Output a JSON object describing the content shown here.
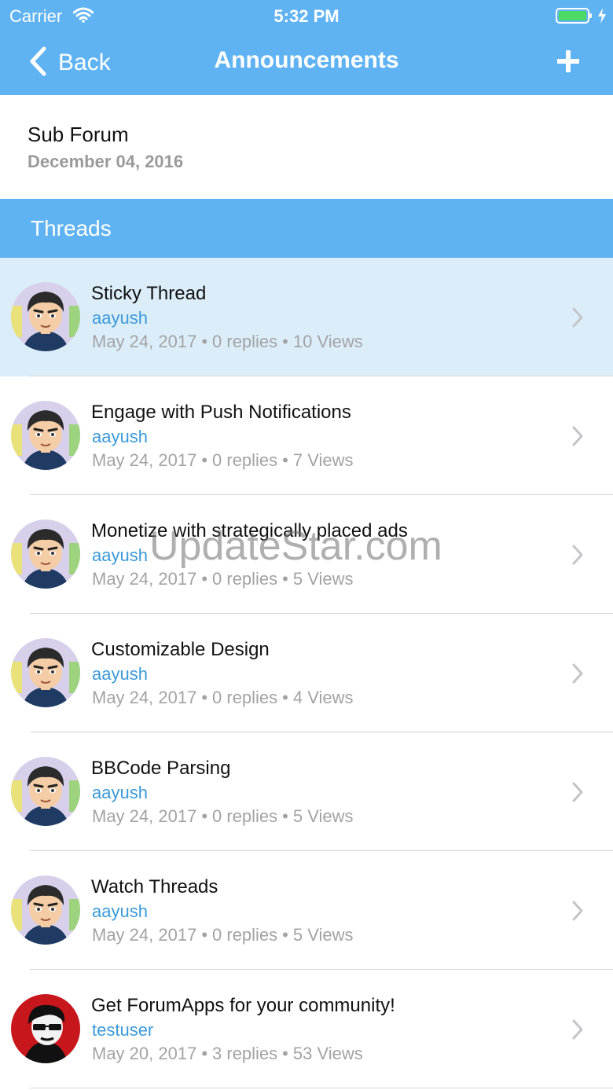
{
  "status_bar": {
    "carrier": "Carrier",
    "time": "5:32 PM",
    "wifi_icon": "wifi-icon",
    "battery_icon": "battery-icon",
    "charging_icon": "charging-icon"
  },
  "nav": {
    "back_label": "Back",
    "back_icon": "chevron-left-icon",
    "title": "Announcements",
    "add_icon": "plus-icon"
  },
  "subforum": {
    "title": "Sub Forum",
    "date": "December 04, 2016"
  },
  "section": {
    "title": "Threads"
  },
  "threads": [
    {
      "title": "Sticky Thread",
      "author": "aayush",
      "date": "May 24, 2017",
      "replies": "0 replies",
      "views": "10 Views",
      "avatar": "cartoon-avatar",
      "highlighted": true
    },
    {
      "title": "Engage with Push Notifications",
      "author": "aayush",
      "date": "May 24, 2017",
      "replies": "0 replies",
      "views": "7 Views",
      "avatar": "cartoon-avatar"
    },
    {
      "title": "Monetize with strategically placed ads",
      "author": "aayush",
      "date": "May 24, 2017",
      "replies": "0 replies",
      "views": "5 Views",
      "avatar": "cartoon-avatar"
    },
    {
      "title": "Customizable Design",
      "author": "aayush",
      "date": "May 24, 2017",
      "replies": "0 replies",
      "views": "4 Views",
      "avatar": "cartoon-avatar"
    },
    {
      "title": "BBCode Parsing",
      "author": "aayush",
      "date": "May 24, 2017",
      "replies": "0 replies",
      "views": "5 Views",
      "avatar": "cartoon-avatar"
    },
    {
      "title": "Watch Threads",
      "author": "aayush",
      "date": "May 24, 2017",
      "replies": "0 replies",
      "views": "5 Views",
      "avatar": "cartoon-avatar"
    },
    {
      "title": "Get ForumApps for your community!",
      "author": "testuser",
      "date": "May 20, 2017",
      "replies": "3 replies",
      "views": "53 Views",
      "avatar": "red-sunglasses-avatar"
    }
  ],
  "meta_separator": "•",
  "watermark": "UpdateStar.com",
  "colors": {
    "accent": "#5fb3f3",
    "highlight_row": "#dcedfa",
    "author_link": "#3a9ad9",
    "meta_text": "#a3a3a3"
  }
}
